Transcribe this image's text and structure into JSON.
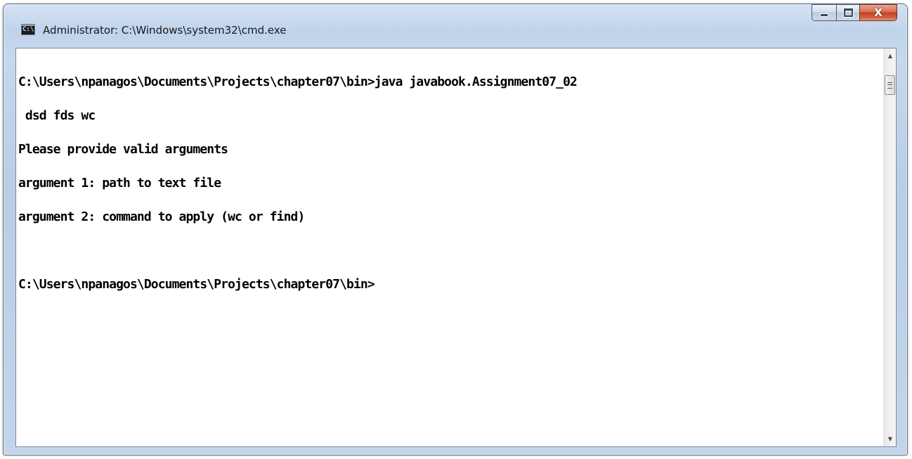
{
  "window": {
    "title": "Administrator: C:\\Windows\\system32\\cmd.exe",
    "icon": "cmd-console-icon",
    "icon_text": "C:\\",
    "controls": {
      "minimize": "minimize-icon",
      "maximize": "maximize-icon",
      "close": "close-icon",
      "close_glyph": "X"
    }
  },
  "console": {
    "lines": [
      "C:\\Users\\npanagos\\Documents\\Projects\\chapter07\\bin>java javabook.Assignment07_02",
      " dsd fds wc",
      "Please provide valid arguments",
      "argument 1: path to text file",
      "argument 2: command to apply (wc or find)",
      "",
      "C:\\Users\\npanagos\\Documents\\Projects\\chapter07\\bin>"
    ]
  },
  "colors": {
    "console_background": "#ffffff",
    "console_text": "#000000",
    "close_button": "#c2411f",
    "frame": "#bfd3ea"
  }
}
